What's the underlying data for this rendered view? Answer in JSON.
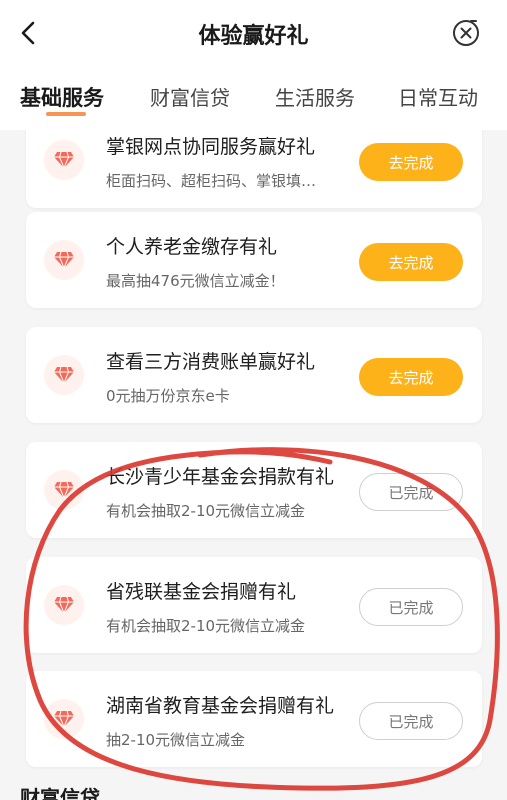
{
  "header": {
    "title": "体验赢好礼",
    "back_icon": "chevron-left-icon",
    "close_icon": "close-circle-icon"
  },
  "tabs": [
    {
      "label": "基础服务",
      "active": true
    },
    {
      "label": "财富信贷",
      "active": false
    },
    {
      "label": "生活服务",
      "active": false
    },
    {
      "label": "日常互动",
      "active": false
    }
  ],
  "tasks": [
    {
      "name": "掌银网点协同服务赢好礼",
      "desc": "柜面扫码、超柜扫码、掌银填…",
      "button": "去完成",
      "status": "todo"
    },
    {
      "name": "个人养老金缴存有礼",
      "desc": "最高抽476元微信立减金！",
      "button": "去完成",
      "status": "todo"
    },
    {
      "name": "查看三方消费账单赢好礼",
      "desc": "0元抽万份京东e卡",
      "button": "去完成",
      "status": "todo"
    },
    {
      "name": "长沙青少年基金会捐款有礼",
      "desc": "有机会抽取2-10元微信立减金",
      "button": "已完成",
      "status": "done"
    },
    {
      "name": "省残联基金会捐赠有礼",
      "desc": "有机会抽取2-10元微信立减金",
      "button": "已完成",
      "status": "done"
    },
    {
      "name": "湖南省教育基金会捐赠有礼",
      "desc": "抽2-10元微信立减金",
      "button": "已完成",
      "status": "done"
    }
  ],
  "next_section": {
    "title": "财富信贷"
  },
  "colors": {
    "accent": "#f47a2a",
    "todo_button": "#fdb21a",
    "annotation_stroke": "#d9342b"
  }
}
